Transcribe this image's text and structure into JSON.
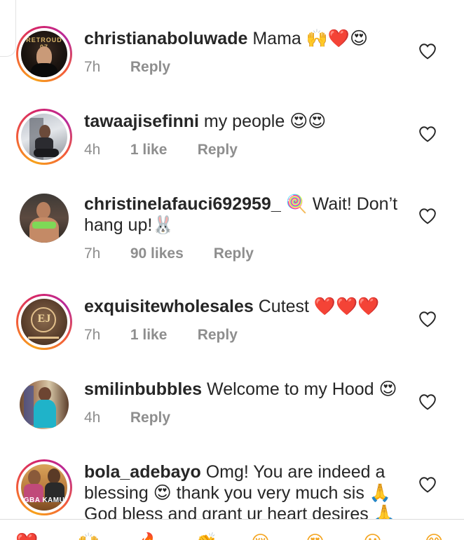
{
  "comments": [
    {
      "username": "christianaboluwade",
      "text": "Mama 🙌❤️😍",
      "time": "7h",
      "likes": "",
      "reply": "Reply"
    },
    {
      "username": "tawaajisefinni",
      "text": "my people 😍😍",
      "time": "4h",
      "likes": "1 like",
      "reply": "Reply"
    },
    {
      "username": "christinelafauci692959_",
      "text": "🍭 Wait! Don’t hang up!🐰",
      "time": "7h",
      "likes": "90 likes",
      "reply": "Reply"
    },
    {
      "username": "exquisitewholesales",
      "text": "Cutest ❤️❤️❤️",
      "time": "7h",
      "likes": "1 like",
      "reply": "Reply"
    },
    {
      "username": "smilinbubbles",
      "text": "Welcome to my Hood 😍",
      "time": "4h",
      "likes": "",
      "reply": "Reply"
    },
    {
      "username": "bola_adebayo",
      "text": "Omg! You are indeed a blessing 😍 thank you very much sis 🙏 God bless and grant ur heart desires 🙏",
      "time": "",
      "likes": "",
      "reply": ""
    }
  ],
  "avatar_text": {
    "c0": "RETROUD 07",
    "c3": "EJ",
    "c5": "GBA KAMU"
  },
  "icons": {
    "like": "heart-outline-icon"
  },
  "emoji_tray": [
    "❤️",
    "🙌",
    "🔥",
    "👏",
    "😢",
    "😍",
    "😮",
    "😂"
  ],
  "colors": {
    "text": "#262626",
    "meta": "#8e8e8e",
    "story_ring_start": "#f7a21b",
    "story_ring_end": "#d3246b"
  }
}
